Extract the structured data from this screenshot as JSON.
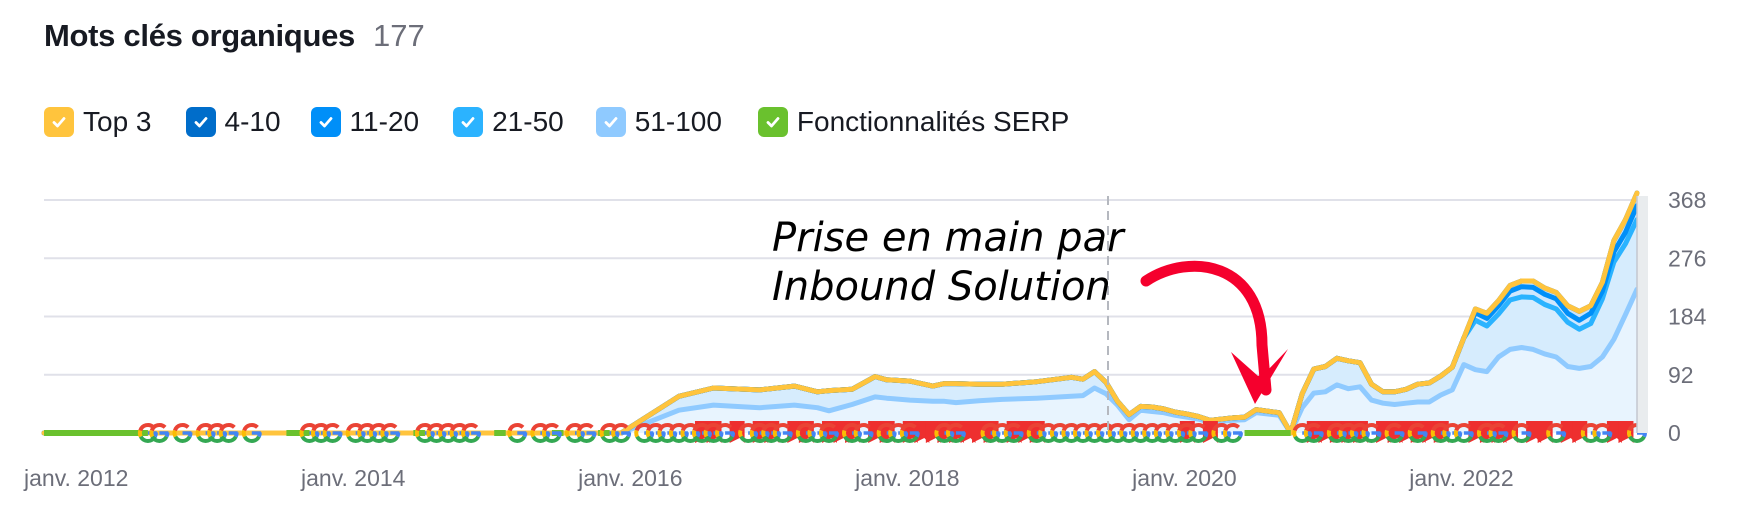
{
  "header": {
    "title": "Mots clés organiques",
    "count": "177"
  },
  "legend": [
    {
      "label": "Top 3",
      "color": "#ffc43d",
      "checked": true,
      "icon": "check-icon"
    },
    {
      "label": "4-10",
      "color": "#006dca",
      "checked": true,
      "icon": "check-icon"
    },
    {
      "label": "11-20",
      "color": "#008ff8",
      "checked": true,
      "icon": "check-icon"
    },
    {
      "label": "21-50",
      "color": "#2bb3ff",
      "checked": true,
      "icon": "check-icon"
    },
    {
      "label": "51-100",
      "color": "#8fcaff",
      "checked": true,
      "icon": "check-icon"
    },
    {
      "label": "Fonctionnalités SERP",
      "color": "#6ac12e",
      "checked": true,
      "icon": "check-icon"
    }
  ],
  "annotation": {
    "line1": "Prise en main par",
    "line2": "Inbound Solution",
    "arrow_color": "#f5002d",
    "marker_date": "2019-09"
  },
  "chart_data": {
    "type": "area",
    "title": "Mots clés organiques",
    "xlabel": "",
    "ylabel": "",
    "ylim": [
      0,
      368
    ],
    "yticks": [
      0,
      92,
      184,
      276,
      368
    ],
    "ytick_labels": [
      "0",
      "92",
      "184",
      "276",
      "368"
    ],
    "xtick_labels": [
      "janv. 2012",
      "janv. 2014",
      "janv. 2016",
      "janv. 2018",
      "janv. 2020",
      "janv. 2022"
    ],
    "x_range": [
      "2012-01",
      "2023-07"
    ],
    "grid": true,
    "y_axis_position": "right",
    "legend_position": "top-left",
    "x_months": [
      0,
      40,
      50,
      55,
      58,
      62,
      65,
      67,
      68,
      70,
      72,
      73,
      75,
      77,
      78,
      79,
      81,
      83,
      86,
      89,
      90,
      91,
      92,
      93,
      94,
      95,
      96,
      97,
      98,
      99,
      100,
      101,
      103,
      104,
      105,
      107,
      108,
      109,
      110,
      111,
      112,
      113,
      114,
      115,
      116,
      117,
      118,
      119,
      120,
      121,
      122,
      123,
      124,
      125,
      126,
      127,
      128,
      129,
      130,
      131,
      132,
      133,
      134,
      135,
      136,
      137,
      138
    ],
    "series": [
      {
        "name": "Top 3",
        "color": "#ffc43d",
        "values": [
          0,
          0,
          0,
          0,
          0,
          0,
          0,
          0,
          0,
          0,
          0,
          0,
          0,
          0,
          0,
          0,
          0,
          0,
          0,
          0,
          0,
          0,
          0,
          0,
          0,
          0,
          0,
          0,
          0,
          0,
          0,
          0,
          0,
          0,
          0,
          0,
          0,
          0,
          0,
          0,
          0,
          0,
          0,
          0,
          0,
          0,
          0,
          0,
          0,
          0,
          0,
          0,
          0,
          0,
          0,
          0,
          0,
          0,
          0,
          0,
          0,
          0,
          0,
          0,
          0,
          0,
          0
        ]
      },
      {
        "name": "4-10",
        "color": "#006dca",
        "values": [
          0,
          0,
          0,
          0,
          0,
          0,
          0,
          0,
          0,
          0,
          0,
          0,
          0,
          0,
          0,
          0,
          0,
          0,
          0,
          0,
          0,
          0,
          0,
          0,
          0,
          0,
          0,
          0,
          0,
          0,
          0,
          0,
          0,
          0,
          0,
          0,
          0,
          0,
          0,
          0,
          0,
          0,
          0,
          0,
          0,
          0,
          0,
          0,
          0,
          0,
          0,
          0,
          6,
          8,
          8,
          9,
          9,
          10,
          10,
          10,
          12,
          14,
          12,
          14,
          18,
          20,
          20
        ]
      },
      {
        "name": "11-20",
        "color": "#008ff8",
        "values": [
          0,
          0,
          0,
          0,
          0,
          0,
          0,
          0,
          0,
          0,
          0,
          0,
          0,
          0,
          0,
          0,
          0,
          0,
          0,
          0,
          0,
          0,
          0,
          0,
          0,
          0,
          0,
          0,
          0,
          0,
          0,
          0,
          0,
          0,
          0,
          0,
          0,
          0,
          0,
          0,
          0,
          0,
          0,
          0,
          0,
          0,
          0,
          0,
          0,
          0,
          0,
          0,
          12,
          12,
          13,
          14,
          16,
          16,
          16,
          16,
          14,
          14,
          16,
          12,
          16,
          18,
          22
        ]
      },
      {
        "name": "21-50",
        "color": "#2bb3ff",
        "values": [
          0,
          0,
          0,
          22,
          27,
          28,
          30,
          25,
          32,
          24,
          32,
          29,
          30,
          24,
          28,
          30,
          26,
          24,
          26,
          30,
          26,
          26,
          18,
          6,
          8,
          6,
          7,
          6,
          5,
          5,
          4,
          3,
          4,
          4,
          5,
          4,
          0,
          22,
          38,
          40,
          42,
          44,
          38,
          25,
          18,
          20,
          22,
          28,
          30,
          30,
          36,
          42,
          78,
          72,
          68,
          78,
          80,
          82,
          78,
          76,
          70,
          62,
          68,
          92,
          122,
          112,
          110
        ]
      },
      {
        "name": "51-100",
        "color": "#8fcaff",
        "values": [
          0,
          0,
          0,
          36,
          44,
          40,
          44,
          40,
          35,
          45,
          57,
          55,
          52,
          50,
          50,
          48,
          51,
          53,
          55,
          58,
          59,
          71,
          62,
          44,
          21,
          36,
          34,
          32,
          28,
          25,
          22,
          17,
          20,
          21,
          32,
          28,
          0,
          40,
          63,
          65,
          76,
          70,
          73,
          52,
          47,
          45,
          47,
          49,
          49,
          60,
          68,
          108,
          100,
          97,
          120,
          132,
          135,
          132,
          125,
          120,
          105,
          102,
          105,
          120,
          148,
          187,
          227
        ]
      }
    ]
  },
  "serp_features": {
    "green_segments": [
      [
        0,
        9
      ],
      [
        21,
        23
      ],
      [
        32,
        33
      ],
      [
        39,
        40
      ],
      [
        44,
        45
      ],
      [
        48,
        49
      ],
      [
        104,
        108
      ]
    ],
    "google_icon_months": [
      9,
      10,
      12,
      14,
      15,
      16,
      18,
      23,
      24,
      25,
      27,
      28,
      29,
      30,
      33,
      34,
      35,
      36,
      37,
      41,
      43,
      44,
      46,
      47,
      49,
      50,
      52,
      53,
      54,
      55,
      56,
      57,
      58,
      59,
      61,
      62,
      63,
      64,
      66,
      67,
      68,
      70,
      71,
      73,
      74,
      75,
      78,
      79,
      82,
      83,
      84,
      86,
      87,
      88,
      89,
      90,
      91,
      92,
      93,
      94,
      95,
      96,
      97,
      98,
      99,
      100,
      102,
      103,
      109,
      110,
      112,
      113,
      114,
      115,
      117,
      119,
      121,
      122,
      123,
      125,
      126,
      128,
      131,
      134,
      135,
      138
    ],
    "flag_months": [
      57,
      58,
      60,
      62,
      63,
      65,
      66,
      68,
      69,
      70,
      72,
      73,
      75,
      76,
      77,
      78,
      79,
      80,
      81,
      82,
      84,
      85,
      86,
      99,
      101,
      110,
      111,
      112,
      113,
      114,
      116,
      117,
      118,
      119,
      120,
      121,
      124,
      125,
      126,
      127,
      129,
      130,
      132,
      133,
      136,
      137
    ]
  }
}
